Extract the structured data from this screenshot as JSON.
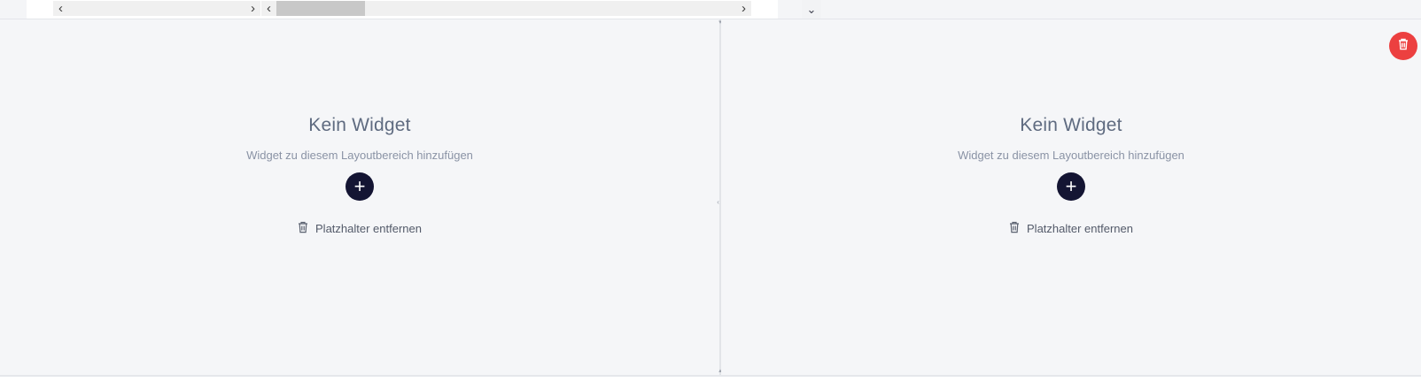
{
  "toolbar": {
    "scroll_left_glyph": "‹",
    "scroll_right_glyph": "›",
    "dropdown_glyph": "⌄"
  },
  "colors": {
    "accent_dark": "#141533",
    "danger": "#ec4040",
    "panel_bg": "#f5f6f8"
  },
  "panels": [
    {
      "title": "Kein Widget",
      "subtitle": "Widget zu diesem Layoutbereich hinzufügen",
      "add_glyph": "+",
      "remove_label": "Platzhalter entfernen",
      "remove_icon": "trash-icon"
    },
    {
      "title": "Kein Widget",
      "subtitle": "Widget zu diesem Layoutbereich hinzufügen",
      "add_glyph": "+",
      "remove_label": "Platzhalter entfernen",
      "remove_icon": "trash-icon"
    }
  ],
  "delete_button": {
    "icon": "trash-icon"
  }
}
